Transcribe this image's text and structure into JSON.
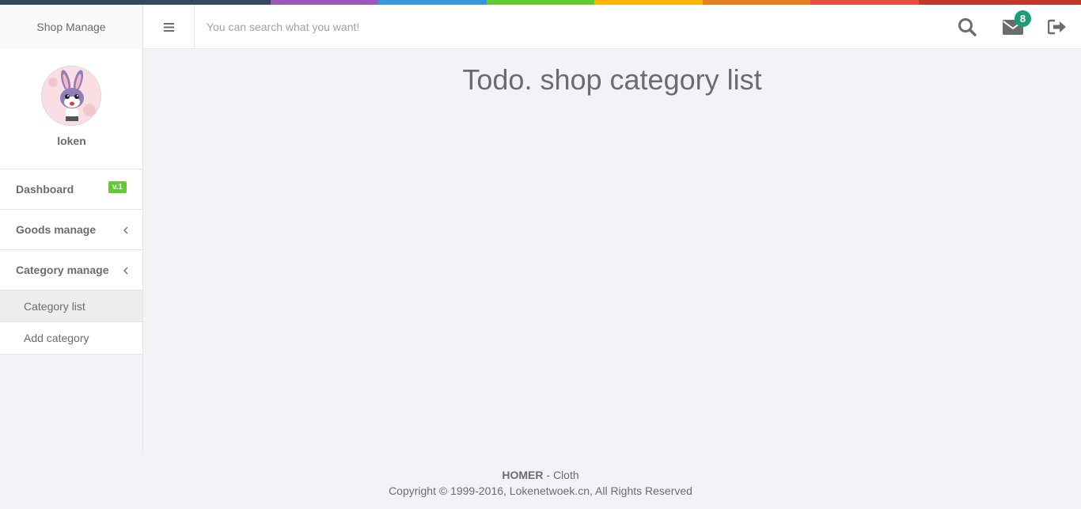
{
  "header": {
    "brand": "Shop Manage",
    "search_placeholder": "You can search what you want!",
    "mail_count": "8",
    "color_line": [
      "#34495e",
      "#9b59b6",
      "#3498db",
      "#62cb31",
      "#ffb606",
      "#e67e22",
      "#e74c3c",
      "#c0392b"
    ]
  },
  "profile": {
    "name": "loken"
  },
  "sidebar": {
    "items": [
      {
        "label": "Dashboard",
        "badge": "v.1"
      },
      {
        "label": "Goods manage",
        "icon": "chevron-left-icon"
      },
      {
        "label": "Category manage",
        "icon": "chevron-left-icon"
      }
    ],
    "sub_items": [
      {
        "label": "Category list",
        "active": true
      },
      {
        "label": "Add category",
        "active": false
      }
    ]
  },
  "main": {
    "title": "Todo. shop category list"
  },
  "footer": {
    "brand": "HOMER",
    "brand_suffix": " - Cloth",
    "copyright": "Copyright © 1999-2016, Lokenetwoek.cn, All Rights Reserved"
  },
  "colors": {
    "accent_badge": "#62cb31",
    "mail_badge": "#1b9e77",
    "text": "#6a6c6f"
  }
}
